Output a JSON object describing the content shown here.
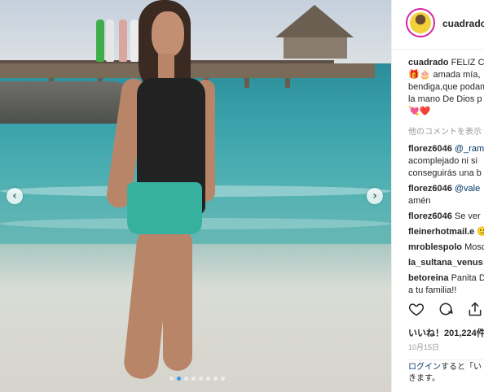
{
  "header": {
    "username": "cuadrado",
    "avatar_icon": "profile-avatar"
  },
  "caption": {
    "user": "cuadrado",
    "line1": "FELIZ C",
    "line2": "🎁🎂 amada mía,",
    "line3": "bendiga,que podam",
    "line4": "la mano De Dios p",
    "line5": "💘❤️"
  },
  "load_more": "他のコメントを表示",
  "comments": [
    {
      "user": "florez6046",
      "mention": "@_ram",
      "lines": [
        "acomplejado ni si",
        "conseguirás una b"
      ]
    },
    {
      "user": "florez6046",
      "mention": "@vale",
      "lines": [
        "amén"
      ]
    },
    {
      "user": "florez6046",
      "text": "Se ver"
    },
    {
      "user": "fleinerhotmail.e",
      "text": "🙂"
    },
    {
      "user": "mroblespolo",
      "text": "Mosc"
    },
    {
      "user": "la_sultana_venus",
      "text": ""
    },
    {
      "user": "betoreina",
      "text": "Panita D",
      "lines": [
        "a tu familia!!"
      ]
    }
  ],
  "likes": "いいね！201,224件",
  "date": "10月15日",
  "login": {
    "link": "ログイン",
    "text1": "すると「い",
    "text2": "きます。"
  },
  "carousel": {
    "dots": 8,
    "active": 1
  },
  "colors": {
    "accent": "#3897f0",
    "link": "#003569"
  }
}
